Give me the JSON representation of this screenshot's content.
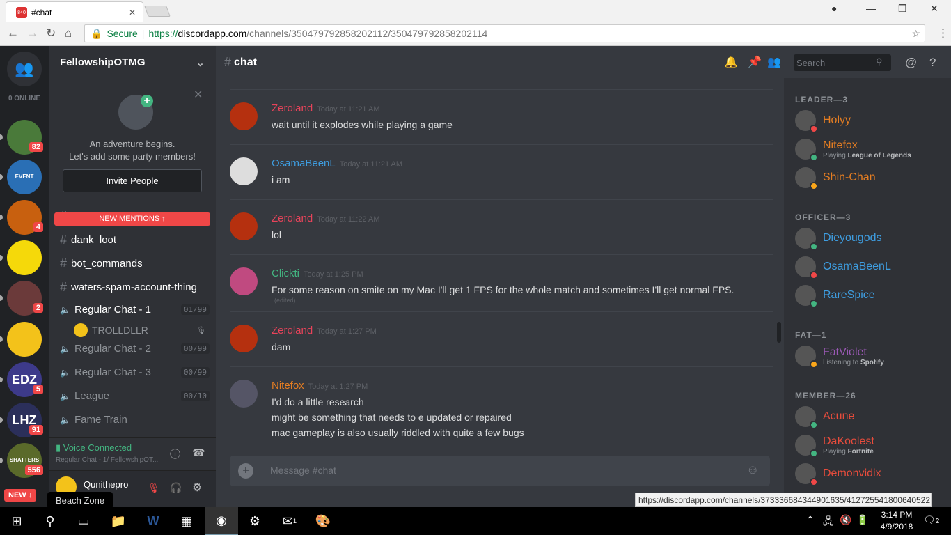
{
  "browser": {
    "tab_title": "#chat",
    "favicon_text": "840",
    "secure_label": "Secure",
    "url_scheme": "https://",
    "url_host": "discordapp.com",
    "url_path": "/channels/350479792858202112/350479792858202114",
    "status_url": "https://discordapp.com/channels/373336684344901635/412725541800640522"
  },
  "guilds": {
    "online_label": "0 ONLINE",
    "items": [
      {
        "badge": "82",
        "color": "#4a7a3a"
      },
      {
        "badge": "",
        "color": "#2a6fb5",
        "text": "EVENT GRINDERS"
      },
      {
        "badge": "4",
        "color": "#c8600f"
      },
      {
        "badge": "",
        "color": "#f5d90a"
      },
      {
        "badge": "2",
        "color": "#6b3a3a"
      },
      {
        "badge": "",
        "color": "#f3c21a"
      },
      {
        "badge": "5",
        "color": "#3d3a8a",
        "text": "EDZ"
      },
      {
        "badge": "91",
        "color": "#2b2f5a",
        "text": "LHZ"
      },
      {
        "badge": "556",
        "color": "#5a6a2a",
        "text": "SHATTERS"
      }
    ],
    "new_label": "NEW ↓",
    "tooltip": "Beach Zone"
  },
  "server": {
    "name": "FellowshipOTMG",
    "invite": {
      "line1": "An adventure begins.",
      "line2": "Let's add some party members!",
      "button": "Invite People"
    },
    "new_mentions": "NEW MENTIONS ↑",
    "channels": [
      {
        "type": "text",
        "name": "rip"
      },
      {
        "type": "text",
        "name": "dank_loot"
      },
      {
        "type": "text",
        "name": "bot_commands"
      },
      {
        "type": "text",
        "name": "waters-spam-account-thing"
      },
      {
        "type": "voice",
        "name": "Regular Chat - 1",
        "count": "01/99",
        "active": true
      },
      {
        "type": "voice",
        "name": "Regular Chat - 2",
        "count": "00/99"
      },
      {
        "type": "voice",
        "name": "Regular Chat - 3",
        "count": "00/99"
      },
      {
        "type": "voice",
        "name": "League",
        "count": "00/10"
      },
      {
        "type": "voice",
        "name": "Fame Train",
        "count": ""
      }
    ],
    "voice_user": "TROLLDLLR",
    "voice": {
      "status": "Voice Connected",
      "detail": "Regular Chat - 1/ FellowshipOT..."
    },
    "user": {
      "name": "Qunithepro"
    }
  },
  "chat": {
    "channel": "chat",
    "search_placeholder": "Search",
    "input_placeholder": "Message #chat",
    "messages": [
      {
        "author": "Zeroland",
        "color": "#e8435a",
        "time": "Today at 11:21 AM",
        "lines": [
          "wait until it explodes while playing a game"
        ],
        "avatar": "#b5300f"
      },
      {
        "author": "OsamaBeenL",
        "color": "#3e9de0",
        "time": "Today at 11:21 AM",
        "lines": [
          "i am"
        ],
        "avatar": "#ddd"
      },
      {
        "author": "Zeroland",
        "color": "#e8435a",
        "time": "Today at 11:22 AM",
        "lines": [
          "lol"
        ],
        "avatar": "#b5300f"
      },
      {
        "author": "Clickti",
        "color": "#43b581",
        "time": "Today at 1:25 PM",
        "lines": [
          "For some reason on smite on my Mac I'll get 1 FPS for the whole match and sometimes I'll get normal FPS."
        ],
        "edited": "(edited)",
        "avatar": "#c04a80"
      },
      {
        "author": "Zeroland",
        "color": "#e8435a",
        "time": "Today at 1:27 PM",
        "lines": [
          "dam"
        ],
        "avatar": "#b5300f"
      },
      {
        "author": "Nitefox",
        "color": "#e67e22",
        "time": "Today at 1:27 PM",
        "lines": [
          "I'd do a little research",
          "might be something that needs to e updated or repaired",
          "mac gameplay is also usually  riddled with quite a few bugs"
        ],
        "avatar": "#556"
      }
    ]
  },
  "members": {
    "groups": [
      {
        "role": "LEADER—3",
        "members": [
          {
            "name": "Holyy",
            "color": "#e67e22",
            "status": "#f04747"
          },
          {
            "name": "Nitefox",
            "color": "#e67e22",
            "status": "#43b581",
            "activity": "Playing ",
            "game": "League of Legends"
          },
          {
            "name": "Shin-Chan",
            "color": "#e67e22",
            "status": "#faa61a"
          }
        ]
      },
      {
        "role": "OFFICER—3",
        "members": [
          {
            "name": "Dieyougods",
            "color": "#3e9de0",
            "status": "#43b581"
          },
          {
            "name": "OsamaBeenL",
            "color": "#3e9de0",
            "status": "#f04747"
          },
          {
            "name": "RareSpice",
            "color": "#3e9de0",
            "status": "#43b581"
          }
        ]
      },
      {
        "role": "FAT—1",
        "members": [
          {
            "name": "FatViolet",
            "color": "#9b59b6",
            "status": "#faa61a",
            "activity": "Listening to ",
            "game": "Spotify"
          }
        ]
      },
      {
        "role": "MEMBER—26",
        "members": [
          {
            "name": "Acune",
            "color": "#e74c3c",
            "status": "#43b581"
          },
          {
            "name": "DaKoolest",
            "color": "#e74c3c",
            "status": "#43b581",
            "activity": "Playing ",
            "game": "Fortnite"
          },
          {
            "name": "Demonvidix",
            "color": "#e74c3c",
            "status": "#f04747"
          }
        ]
      }
    ]
  },
  "taskbar": {
    "time": "3:14 PM",
    "date": "4/9/2018",
    "notifications": "2",
    "mail_badge": "1"
  }
}
